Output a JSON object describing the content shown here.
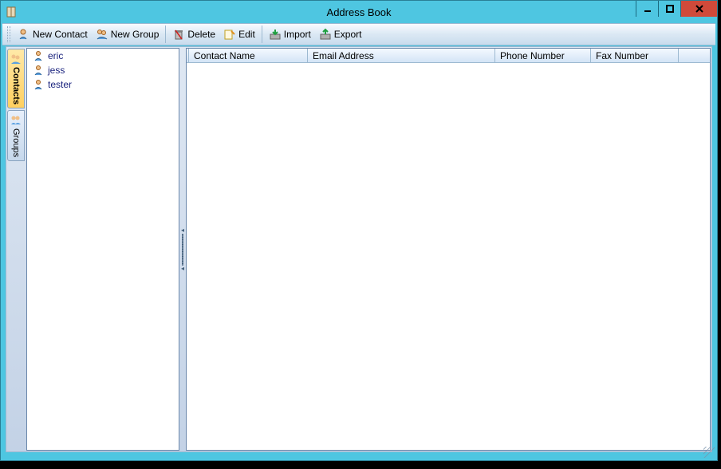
{
  "title": "Address Book",
  "toolbar": {
    "new_contact": "New Contact",
    "new_group": "New Group",
    "delete": "Delete",
    "edit": "Edit",
    "import": "Import",
    "export": "Export"
  },
  "sidetabs": {
    "contacts": "Contacts",
    "groups": "Groups"
  },
  "treelist": [
    {
      "name": "eric"
    },
    {
      "name": "jess"
    },
    {
      "name": "tester"
    }
  ],
  "columns": {
    "contact_name": "Contact Name",
    "email_address": "Email Address",
    "phone_number": "Phone Number",
    "fax_number": "Fax Number"
  }
}
